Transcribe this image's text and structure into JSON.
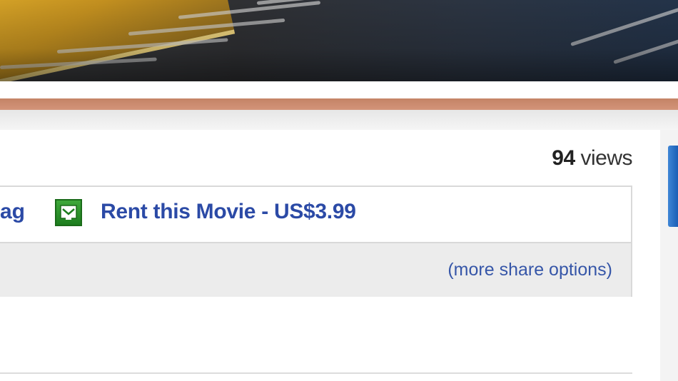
{
  "video": {
    "still_label": "video still"
  },
  "stats": {
    "views_count": "94",
    "views_label": "views"
  },
  "actions": {
    "partial_link": "ag",
    "rent_label": "Rent this Movie - US$3.99",
    "rent_icon": "rent-ticket-icon"
  },
  "share": {
    "more_share_options": "(more share options)"
  },
  "colors": {
    "link": "#2b4aa6",
    "band_orange": "#c48366",
    "rent_icon_green": "#2a8f2a",
    "rail_blue": "#1b5eb5"
  }
}
